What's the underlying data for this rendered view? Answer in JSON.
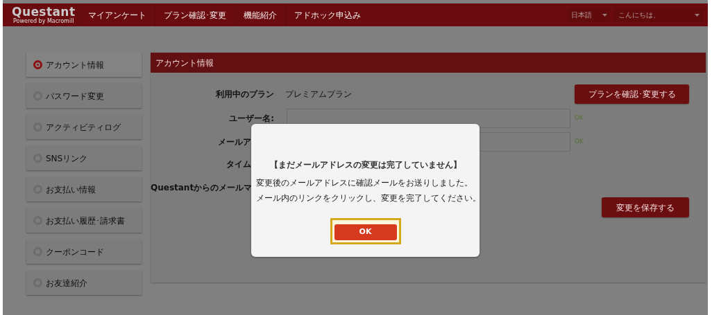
{
  "header": {
    "logo": "Questant",
    "tagline": "Powered by Macromill",
    "nav": [
      "マイアンケート",
      "プラン確認･変更",
      "機能紹介",
      "アドホック申込み"
    ],
    "language": "日本語",
    "greeting": "こんにちは、"
  },
  "sidebar": {
    "items": [
      {
        "label": "アカウント情報",
        "selected": true
      },
      {
        "label": "パスワード変更",
        "selected": false
      },
      {
        "label": "アクティビティログ",
        "selected": false
      },
      {
        "label": "SNSリンク",
        "selected": false
      },
      {
        "label": "お支払い情報",
        "selected": false
      },
      {
        "label": "お支払い履歴･請求書",
        "selected": false
      },
      {
        "label": "クーポンコード",
        "selected": false
      },
      {
        "label": "お友達紹介",
        "selected": false
      }
    ]
  },
  "panel": {
    "title": "アカウント情報",
    "rows": [
      {
        "kind": "plan",
        "label": "利用中のプラン",
        "value": "プレミアムプラン",
        "button": "プランを確認･変更する",
        "cut": false
      },
      {
        "kind": "field",
        "label": "ユーザー名:",
        "status": "OK",
        "cut": false
      },
      {
        "kind": "field",
        "label": "メールア",
        "status": "OK",
        "cut": true
      },
      {
        "kind": "text",
        "label": "タイム",
        "cut": true
      },
      {
        "kind": "text",
        "label": "Questantからのメールマ",
        "cut": true
      }
    ],
    "save_button": "変更を保存する"
  },
  "dialog": {
    "title": "【まだメールアドレスの変更は完了していません】",
    "lines": [
      "変更後のメールアドレスに確認メールをお送りしました。",
      "メール内のリンクをクリックし、変更を完了してください。"
    ],
    "ok_button": "OK",
    "focused": true
  }
}
